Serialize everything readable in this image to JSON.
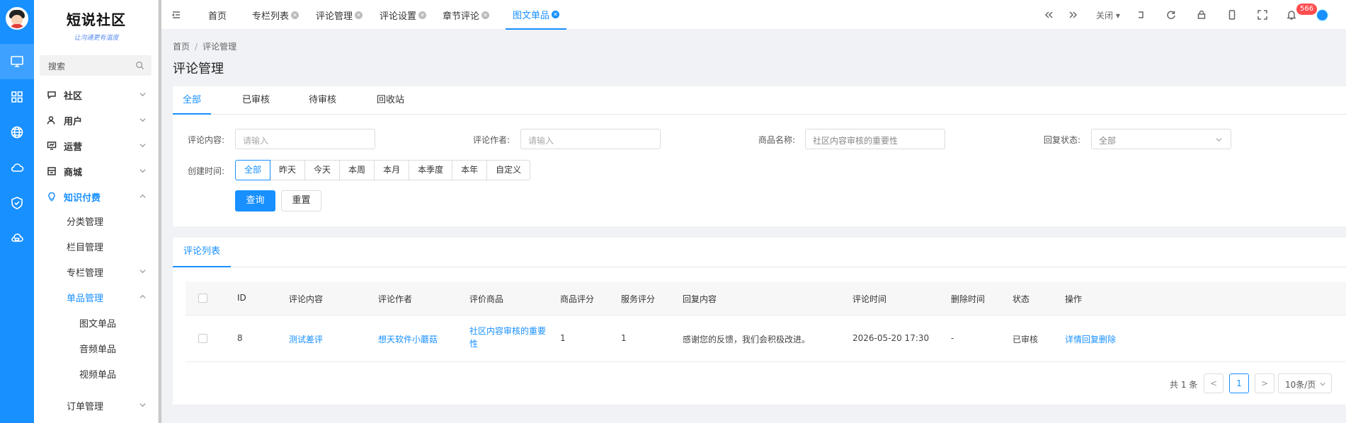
{
  "logo": {
    "title": "短说社区",
    "slogan": "让沟通更有温度"
  },
  "search": {
    "placeholder": "搜索"
  },
  "menu": {
    "shequ": "社区",
    "yonghu": "用户",
    "yunying": "运营",
    "shangcheng": "商城",
    "zhishi": "知识付费",
    "fenlei": "分类管理",
    "lanmu": "栏目管理",
    "zhuanlan": "专栏管理",
    "danpin": "单品管理",
    "tuwen": "图文单品",
    "yinpin": "音频单品",
    "shipin": "视频单品",
    "dingdan": "订单管理"
  },
  "tabs": {
    "home": "首页",
    "column_list": "专栏列表",
    "comment_mgmt": "评论管理",
    "comment_settings": "评论设置",
    "chapter_comment": "章节评论",
    "tuwen_item": "图文单品"
  },
  "toolbar": {
    "close_label": "关闭",
    "notification_count": "566"
  },
  "breadcrumb": {
    "home": "首页",
    "current": "评论管理"
  },
  "page_title": "评论管理",
  "status_tabs": {
    "all": "全部",
    "approved": "已审核",
    "pending": "待审核",
    "recycle": "回收站"
  },
  "filters": {
    "content_label": "评论内容:",
    "content_placeholder": "请输入",
    "author_label": "评论作者:",
    "author_placeholder": "请输入",
    "product_label": "商品名称:",
    "product_value": "社区内容审核的重要性",
    "reply_label": "回复状态:",
    "reply_value": "全部",
    "time_label": "创建时间:",
    "time_options": [
      "全部",
      "昨天",
      "今天",
      "本周",
      "本月",
      "本季度",
      "本年",
      "自定义"
    ],
    "query_button": "查询",
    "reset_button": "重置"
  },
  "table": {
    "tab": "评论列表",
    "headers": [
      "ID",
      "评论内容",
      "评论作者",
      "评价商品",
      "商品评分",
      "服务评分",
      "回复内容",
      "评论时间",
      "删除时间",
      "状态",
      "操作"
    ],
    "rows": [
      {
        "id": "8",
        "content": "测试差评",
        "author": "想天软件小蘑菇",
        "product_line1": "社区内容审核的重要",
        "product_line2": "性",
        "product_score": "1",
        "service_score": "1",
        "reply": "感谢您的反馈，我们会积极改进。",
        "time": "2026-05-20 17:30",
        "deleted": "-",
        "status": "已审核",
        "action_detail": "详情",
        "action_reply": "回复",
        "action_delete": "删除"
      }
    ]
  },
  "pagination": {
    "total": "共 1 条",
    "prev": "<",
    "page": "1",
    "next": ">",
    "page_size": "10条/页"
  },
  "colors": {
    "accent": "#1890ff",
    "badge": "#ff4d4f"
  }
}
